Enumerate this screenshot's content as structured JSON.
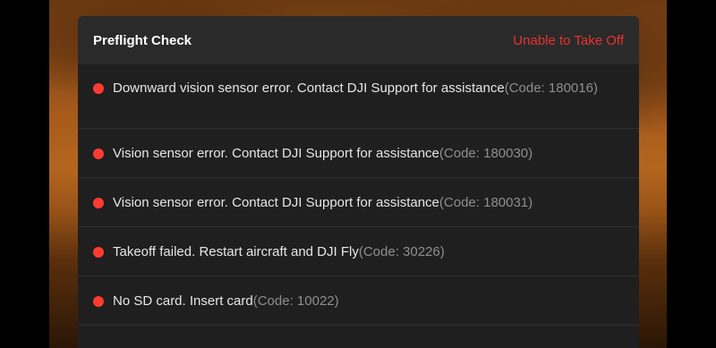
{
  "panel": {
    "title": "Preflight Check",
    "status": "Unable to Take Off",
    "status_color": "#e8322e"
  },
  "errors": [
    {
      "message": "Downward vision sensor error. Contact DJI Support for assistance",
      "code": "(Code: 180016)",
      "status_icon": "red-dot"
    },
    {
      "message": "Vision sensor error. Contact DJI Support for assistance",
      "code": "(Code: 180030)",
      "status_icon": "red-dot"
    },
    {
      "message": "Vision sensor error. Contact DJI Support for assistance",
      "code": "(Code: 180031)",
      "status_icon": "red-dot"
    },
    {
      "message": "Takeoff failed. Restart aircraft and DJI Fly",
      "code": "(Code: 30226)",
      "status_icon": "red-dot"
    },
    {
      "message": "No SD card. Insert card",
      "code": "(Code: 10022)",
      "status_icon": "red-dot"
    }
  ]
}
